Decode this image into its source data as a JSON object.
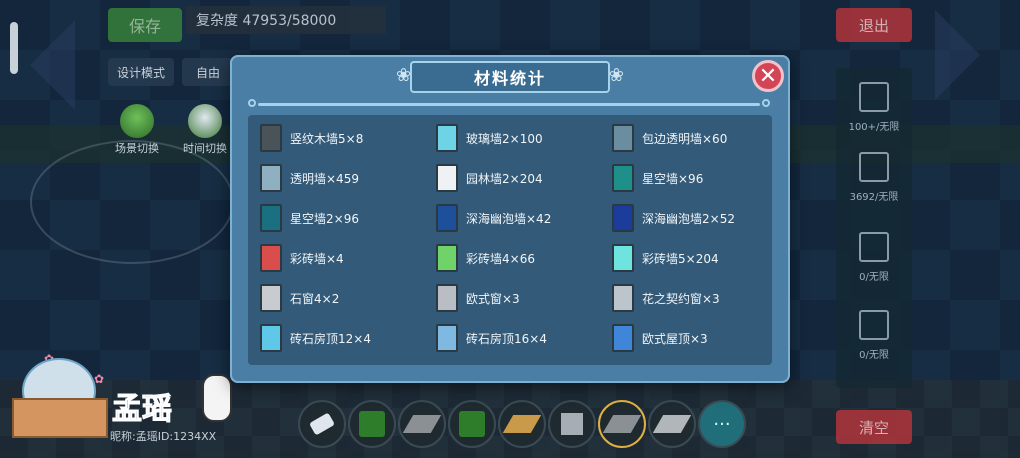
{
  "hud": {
    "save": "保存",
    "complexity": "复杂度 47953/58000",
    "design_mode": "设计模式",
    "free": "自由",
    "scene_switch": "场景切换",
    "time_switch": "时间切换",
    "exit": "退出",
    "clear": "清空",
    "right_items": [
      "100+/无限",
      "3692/无限",
      "0/无限",
      "0/无限"
    ]
  },
  "toolbar": {
    "tools": [
      "eraser-icon",
      "grass-block",
      "stone-slab",
      "grass-block",
      "wood-floor",
      "stone-block",
      "stone-slab-selected",
      "stone-slab"
    ],
    "more": "···"
  },
  "watermark": {
    "name": "孟瑶",
    "sub": "昵称:孟瑶ID:1234XX"
  },
  "dialog": {
    "title": "材料统计",
    "close_icon": "close-icon",
    "accent": "#4a7ea4",
    "items": [
      {
        "label": "竖纹木墙5×8",
        "icon": "wood-wall-icon",
        "color": "#4a5458"
      },
      {
        "label": "玻璃墙2×100",
        "icon": "glass-wall-icon",
        "color": "#6fd3e6"
      },
      {
        "label": "包边透明墙×60",
        "icon": "edged-transparent-wall-icon",
        "color": "#6a8ea0"
      },
      {
        "label": "透明墙×459",
        "icon": "transparent-wall-icon",
        "color": "#8fb0c0"
      },
      {
        "label": "园林墙2×204",
        "icon": "garden-wall-icon",
        "color": "#eef2f4"
      },
      {
        "label": "星空墙×96",
        "icon": "starry-wall-icon",
        "color": "#1f8f8a"
      },
      {
        "label": "星空墙2×96",
        "icon": "starry-wall-2-icon",
        "color": "#1a6f80"
      },
      {
        "label": "深海幽泡墙×42",
        "icon": "deep-sea-wall-icon",
        "color": "#1d4f9a"
      },
      {
        "label": "深海幽泡墙2×52",
        "icon": "deep-sea-wall-2-icon",
        "color": "#1b3c9a"
      },
      {
        "label": "彩砖墙×4",
        "icon": "red-brick-wall-icon",
        "color": "#d94d4d"
      },
      {
        "label": "彩砖墙4×66",
        "icon": "green-brick-wall-icon",
        "color": "#6fd36a"
      },
      {
        "label": "彩砖墙5×204",
        "icon": "cyan-brick-wall-icon",
        "color": "#6fe3de"
      },
      {
        "label": "石窗4×2",
        "icon": "stone-window-icon",
        "color": "#c8ccd0"
      },
      {
        "label": "欧式窗×3",
        "icon": "european-window-icon",
        "color": "#b8bec4"
      },
      {
        "label": "花之契约窗×3",
        "icon": "flower-window-icon",
        "color": "#bcc4cc"
      },
      {
        "label": "砖石房顶12×4",
        "icon": "brick-roof-cone-icon",
        "color": "#5fc8e8"
      },
      {
        "label": "砖石房顶16×4",
        "icon": "brick-roof-flat-icon",
        "color": "#7fb8e0"
      },
      {
        "label": "欧式屋顶×3",
        "icon": "european-roof-icon",
        "color": "#3f86d8"
      }
    ]
  }
}
